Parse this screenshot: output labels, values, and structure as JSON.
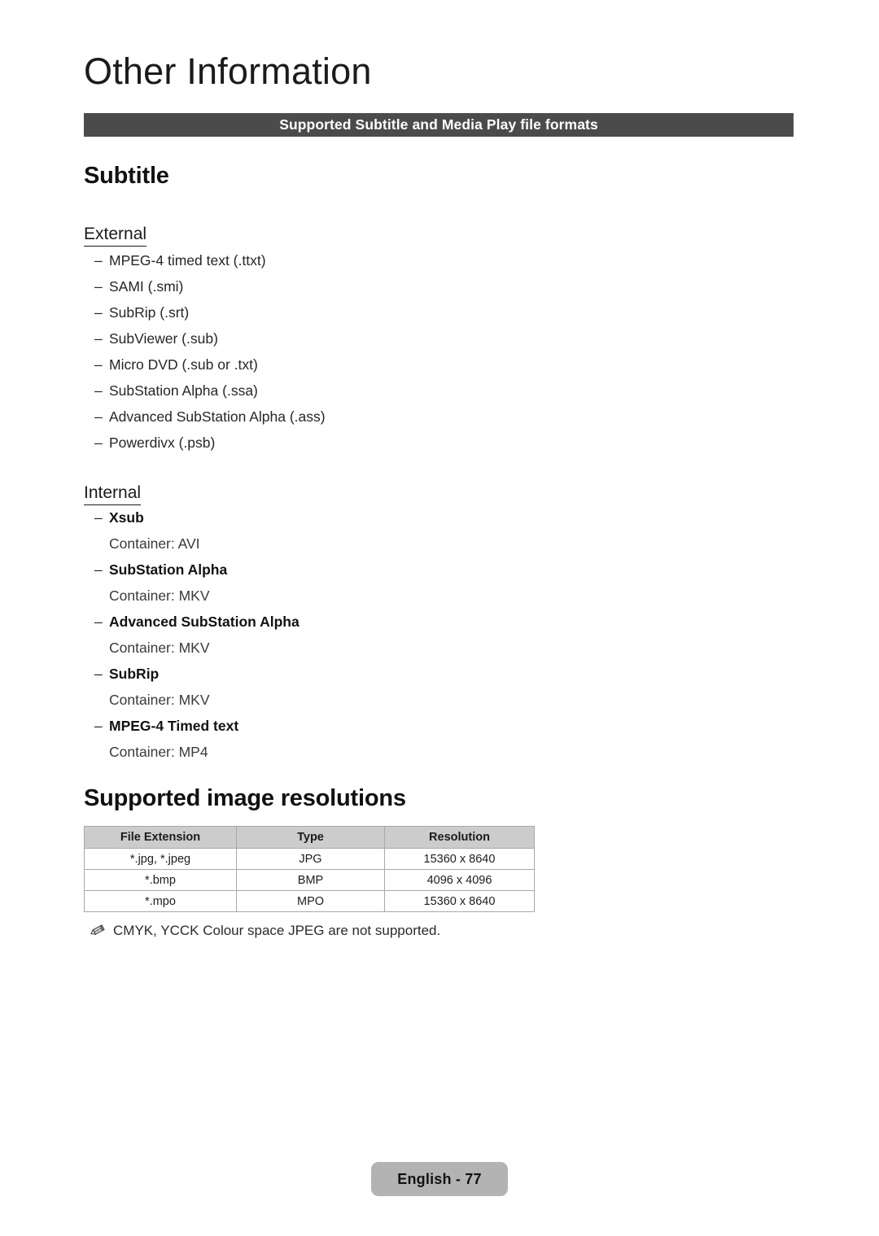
{
  "document": {
    "chapter_title": "Other Information",
    "section_banner": "Supported Subtitle and Media Play file formats"
  },
  "subtitle_section": {
    "heading": "Subtitle",
    "external": {
      "heading": "External",
      "dash": "–",
      "items": [
        "MPEG-4 timed text (.ttxt)",
        "SAMI (.smi)",
        "SubRip (.srt)",
        "SubViewer (.sub)",
        "Micro DVD (.sub or .txt)",
        "SubStation Alpha (.ssa)",
        "Advanced SubStation Alpha (.ass)",
        "Powerdivx (.psb)"
      ]
    },
    "internal": {
      "heading": "Internal",
      "dash": "–",
      "items": [
        {
          "name": "Xsub",
          "container": "Container: AVI"
        },
        {
          "name": "SubStation Alpha",
          "container": "Container: MKV"
        },
        {
          "name": "Advanced SubStation Alpha",
          "container": "Container: MKV"
        },
        {
          "name": "SubRip",
          "container": "Container: MKV"
        },
        {
          "name": "MPEG-4 Timed text",
          "container": "Container: MP4"
        }
      ]
    }
  },
  "image_resolutions_section": {
    "heading": "Supported image resolutions",
    "table": {
      "columns": [
        "File Extension",
        "Type",
        "Resolution"
      ],
      "rows": [
        [
          "*.jpg, *.jpeg",
          "JPG",
          "15360 x 8640"
        ],
        [
          "*.bmp",
          "BMP",
          "4096 x 4096"
        ],
        [
          "*.mpo",
          "MPO",
          "15360 x 8640"
        ]
      ]
    },
    "note": {
      "icon": "pencil-icon",
      "text": "CMYK, YCCK Colour space JPEG are not supported."
    }
  },
  "footer": {
    "page_label": "English - 77"
  },
  "colors": {
    "banner_background": "#4b4b4b",
    "banner_text": "#ffffff",
    "table_header_background": "#cccccc",
    "table_border": "#a9a9a9",
    "footer_pill_background": "#b3b3b3",
    "body_text": "#1a1a1a"
  }
}
